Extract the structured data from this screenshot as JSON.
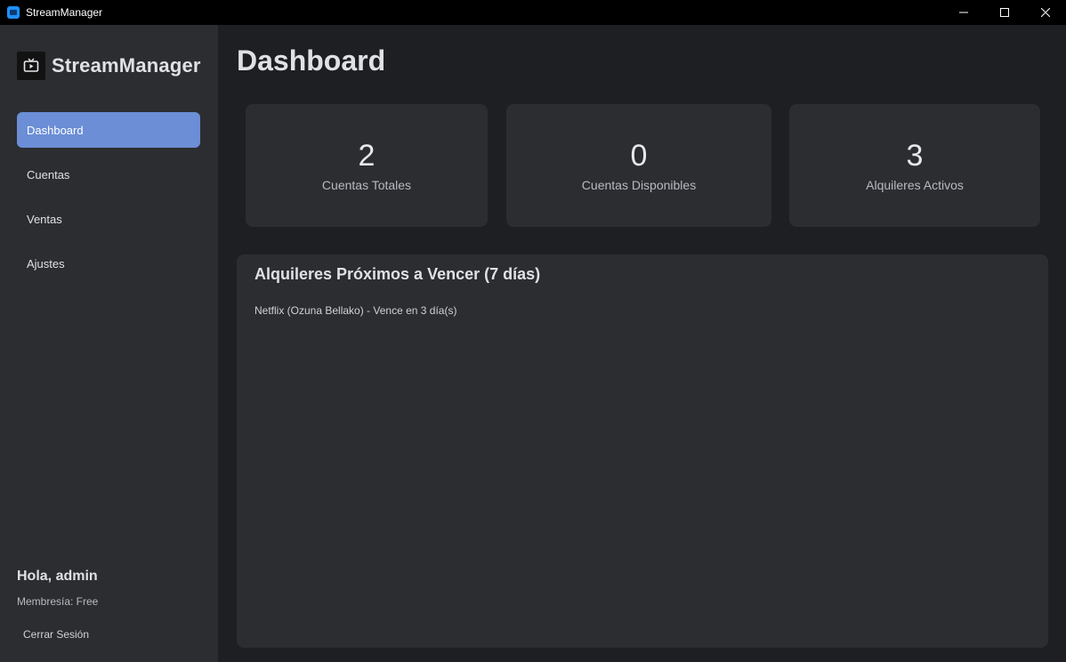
{
  "window": {
    "title": "StreamManager",
    "minimize_icon": "minimize-icon",
    "maximize_icon": "maximize-icon",
    "close_icon": "close-icon"
  },
  "sidebar": {
    "brand_name": "StreamManager",
    "brand_icon": "tv-play-icon",
    "items": [
      {
        "label": "Dashboard",
        "active": true
      },
      {
        "label": "Cuentas",
        "active": false
      },
      {
        "label": "Ventas",
        "active": false
      },
      {
        "label": "Ajustes",
        "active": false
      }
    ],
    "greeting": "Hola, admin",
    "membership": "Membresía: Free",
    "logout_label": "Cerrar Sesión"
  },
  "main": {
    "title": "Dashboard",
    "stats": [
      {
        "value": "2",
        "label": "Cuentas Totales"
      },
      {
        "value": "0",
        "label": "Cuentas Disponibles"
      },
      {
        "value": "3",
        "label": "Alquileres Activos"
      }
    ],
    "expiring_panel": {
      "title": "Alquileres Próximos a Vencer (7 días)",
      "items": [
        "Netflix (Ozuna Bellako) - Vence en 3 día(s)"
      ]
    }
  },
  "colors": {
    "background": "#1e1f22",
    "surface": "#2b2d31",
    "accent": "#6b8ed6",
    "titlebar": "#000000"
  }
}
